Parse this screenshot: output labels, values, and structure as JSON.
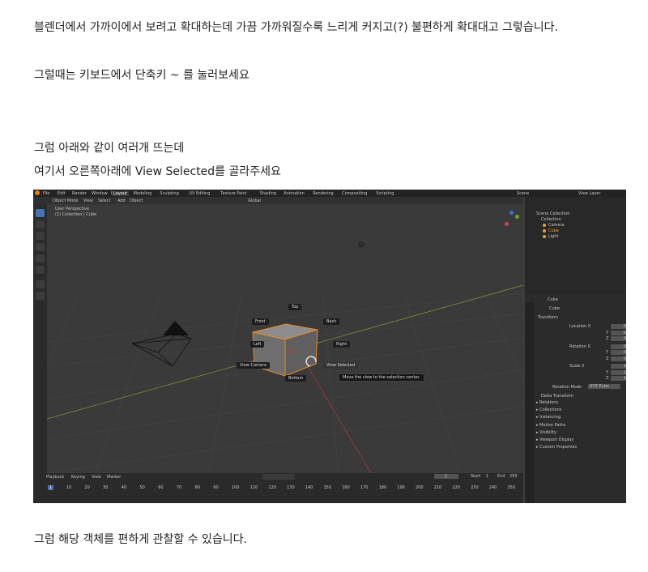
{
  "paragraphs": {
    "p1": "블렌더에서 가까이에서 보려고 확대하는데 가끔 가까워질수록 느리게 커지고(?) 불편하게 확대대고 그렇습니다.",
    "p2": "그럴때는 키보드에서 단축키 ~ 를 눌러보세요",
    "p3": "그럼 아래와 같이 여러개 뜨는데",
    "p4": "여기서 오른쪽아래에 View Selected를 골라주세요",
    "p5": "그럼 해당 객체를 편하게 관찰할 수 있습니다."
  },
  "screenshot": {
    "menus": [
      "File",
      "Edit",
      "Render",
      "Window",
      "Help"
    ],
    "workspaces": [
      "Layout",
      "Modeling",
      "Sculpting",
      "UV Editing",
      "Texture Paint",
      "Shading",
      "Animation",
      "Rendering",
      "Compositing",
      "Scripting"
    ],
    "scene_label": "Scene",
    "view_layer_label": "View Layer",
    "header": {
      "mode": "Object Mode",
      "menus": [
        "View",
        "Select",
        "Add",
        "Object"
      ],
      "orientation": "Global"
    },
    "viewport": {
      "perspective": "User Perspective",
      "collection_info": "(1) Collection | Cube"
    },
    "pie_menu": {
      "top": "Top",
      "front": "Front",
      "back": "Back",
      "left": "Left",
      "right": "Right",
      "view_camera": "View Camera",
      "view_selected": "View Selected",
      "bottom": "Bottom",
      "tooltip": "Move the view to the selection center."
    },
    "outliner": {
      "root": "Scene Collection",
      "collection": "Collection",
      "items": [
        "Camera",
        "Cube",
        "Light"
      ]
    },
    "properties": {
      "object_name": "Cube",
      "transform_title": "Transform",
      "location_label": "Location X",
      "rotation_label": "Rotation X",
      "scale_label": "Scale X",
      "axis_y": "Y",
      "axis_z": "Z",
      "location_values": [
        "0m",
        "0m",
        "0m"
      ],
      "rotation_values": [
        "0°",
        "0°",
        "0°"
      ],
      "scale_values": [
        "1.000",
        "1.000",
        "1.000"
      ],
      "rotation_mode_label": "Rotation Mode",
      "rotation_mode": "XYZ Euler",
      "delta_transform": "Delta Transform",
      "sections": [
        "Relations",
        "Collections",
        "Instancing",
        "Motion Paths",
        "Visibility",
        "Viewport Display",
        "Custom Properties"
      ]
    },
    "timeline": {
      "menus": [
        "Playback",
        "Keying",
        "View",
        "Marker"
      ],
      "current_frame": "1",
      "start_label": "Start",
      "start_value": "1",
      "end_label": "End",
      "end_value": "250",
      "ticks": [
        "1",
        "10",
        "20",
        "30",
        "40",
        "50",
        "60",
        "70",
        "80",
        "90",
        "100",
        "110",
        "120",
        "130",
        "140",
        "150",
        "160",
        "170",
        "180",
        "190",
        "200",
        "210",
        "220",
        "230",
        "240",
        "250"
      ]
    }
  }
}
